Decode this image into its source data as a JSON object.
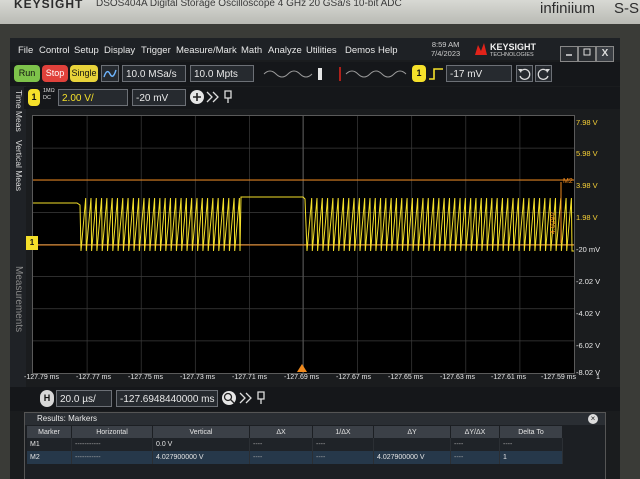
{
  "bezel": {
    "brand": "KEYSIGHT",
    "model": "DSOS404A  Digital Storage Oscilloscope  4 GHz  20 GSa/s  10-bit ADC",
    "series": "infiniium",
    "edge_text": "S-S"
  },
  "menu": {
    "items": [
      "File",
      "Control",
      "Setup",
      "Display",
      "Trigger",
      "Measure/Mark",
      "Math",
      "Analyze",
      "Utilities",
      "Demos",
      "Help"
    ],
    "time": "8:59 AM",
    "date": "7/4/2023",
    "brand": "KEYSIGHT",
    "brand_sub": "TECHNOLOGIES",
    "close": "X"
  },
  "acquisition": {
    "run_label": "Run",
    "stop_label": "Stop",
    "single_label": "Single",
    "sample_rate": "10.0 MSa/s",
    "memory_depth": "10.0 Mpts"
  },
  "trigger": {
    "channel": "1",
    "level": "-17 mV"
  },
  "channel1": {
    "number": "1",
    "coupling_top": "1MΩ",
    "coupling_bottom": "DC",
    "scale": "2.00 V/",
    "offset": "-20 mV",
    "color": "#f5e02a"
  },
  "side_tabs": [
    "Time Meas",
    "Vertical Meas",
    "Measurements"
  ],
  "plot": {
    "grid_color": "#3c3c3c",
    "marker_color": "#f08a1e",
    "marker_m2_label": "M2",
    "marker_m1_label": "M1",
    "marker_delta": "4.028V",
    "ground_label": "1",
    "trigger_label": "T"
  },
  "y_ticks": [
    "7.98 V",
    "5.98 V",
    "3.98 V",
    "1.98 V",
    "-20 mV",
    "-2.02 V",
    "-4.02 V",
    "-6.02 V",
    "-8.02 V"
  ],
  "x_ticks": [
    "-127.79 ms",
    "-127.77 ms",
    "-127.75 ms",
    "-127.73 ms",
    "-127.71 ms",
    "-127.69 ms",
    "-127.67 ms",
    "-127.65 ms",
    "-127.63 ms",
    "-127.61 ms",
    "-127.59 ms"
  ],
  "x_tick_end": "1",
  "horizontal": {
    "label": "H",
    "scale": "20.0 µs/",
    "position": "-127.6948440000 ms"
  },
  "results": {
    "title": "Results: Markers",
    "columns": [
      "Marker",
      "Horizontal",
      "Vertical",
      "ΔX",
      "1/ΔX",
      "ΔY",
      "ΔY/ΔX",
      "Delta To"
    ],
    "rows": [
      [
        "M1",
        "-----------",
        "0.0 V",
        "----",
        "----",
        "",
        "----",
        "----"
      ],
      [
        "M2",
        "-----------",
        "4.027900000 V",
        "----",
        "----",
        "4.027900000 V",
        "----",
        "1"
      ]
    ]
  }
}
